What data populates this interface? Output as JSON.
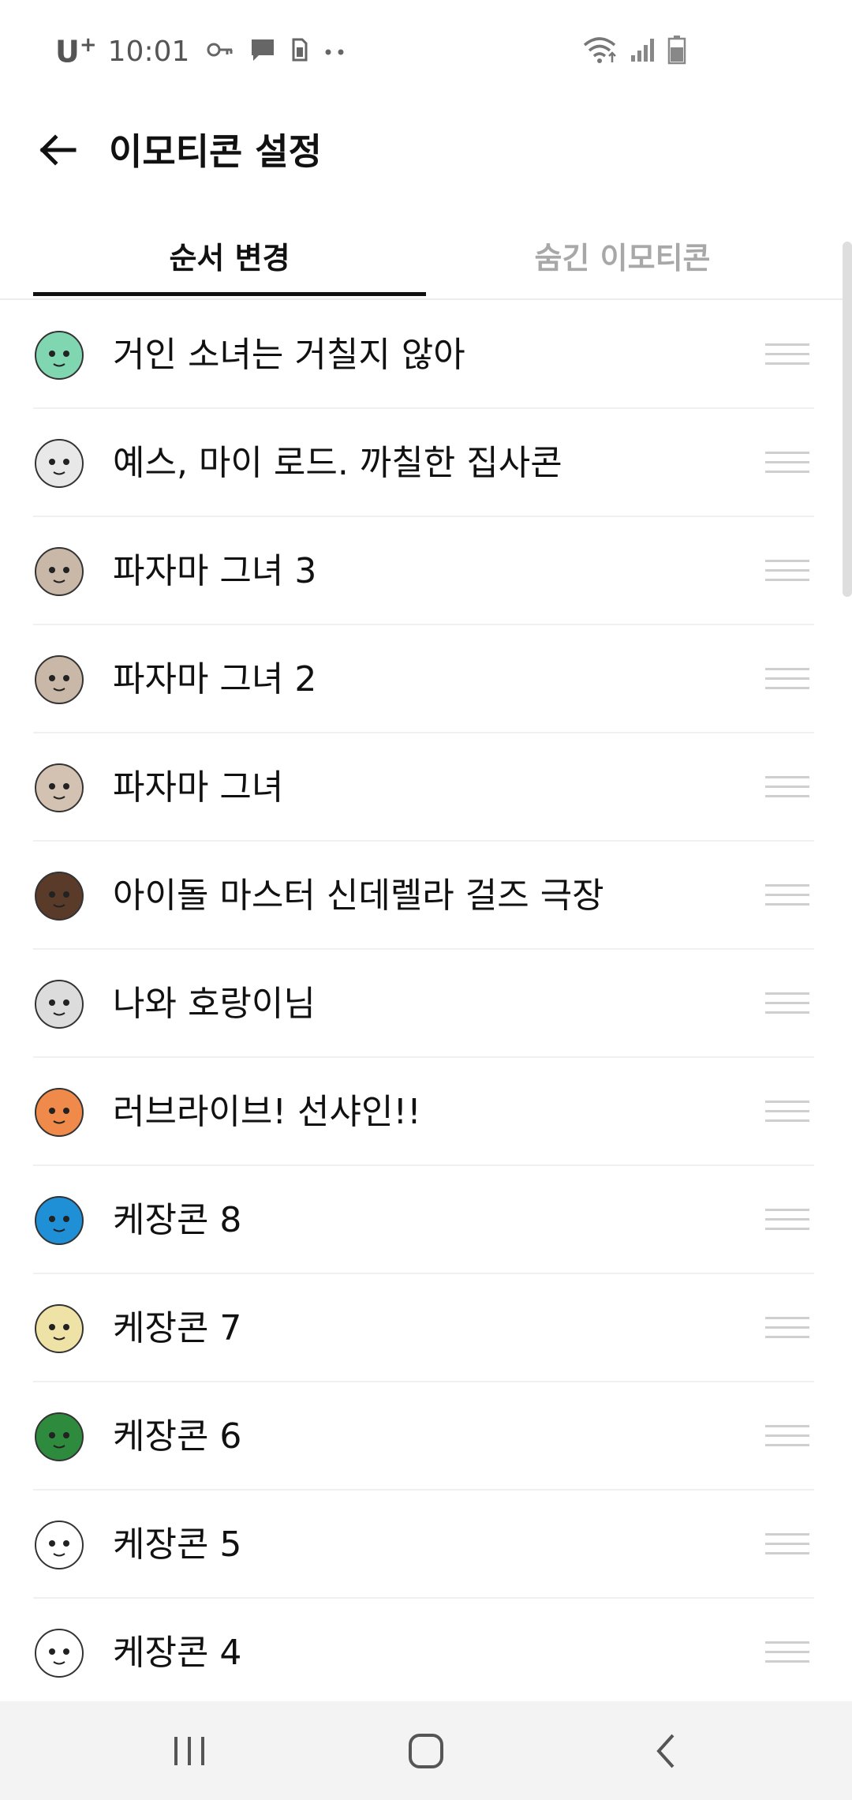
{
  "status_bar": {
    "carrier": "U",
    "carrier_sup": "+",
    "time": "10:01",
    "left_icons": [
      "key-icon",
      "chat-bubble-icon",
      "sim-icon",
      "more-dots-icon"
    ],
    "right_icons": [
      "wifi-icon",
      "signal-icon",
      "battery-icon"
    ]
  },
  "app_bar": {
    "title": "이모티콘 설정",
    "back_icon": "back-arrow-icon"
  },
  "tabs": {
    "order_label": "순서 변경",
    "hidden_label": "숨긴 이모티콘",
    "selected": "순서 변경"
  },
  "list": {
    "items": [
      {
        "label": "거인 소녀는 거칠지 않아",
        "thumb_color": "#7fd6b0"
      },
      {
        "label": "예스, 마이 로드. 까칠한 집사콘",
        "thumb_color": "#e8e8e8"
      },
      {
        "label": "파자마 그녀 3",
        "thumb_color": "#c9b7a7"
      },
      {
        "label": "파자마 그녀 2",
        "thumb_color": "#c9b7a7"
      },
      {
        "label": "파자마 그녀",
        "thumb_color": "#d3c1b1"
      },
      {
        "label": "아이돌 마스터 신데렐라 걸즈 극장",
        "thumb_color": "#5a3b2a"
      },
      {
        "label": "나와 호랑이님",
        "thumb_color": "#dcdcdc"
      },
      {
        "label": "러브라이브! 선샤인!!",
        "thumb_color": "#f08a4b"
      },
      {
        "label": "케장콘 8",
        "thumb_color": "#1f8fd6"
      },
      {
        "label": "케장콘 7",
        "thumb_color": "#efe2a7"
      },
      {
        "label": "케장콘 6",
        "thumb_color": "#2e8b3e"
      },
      {
        "label": "케장콘 5",
        "thumb_color": "#ffffff"
      },
      {
        "label": "케장콘 4",
        "thumb_color": "#ffffff"
      }
    ]
  },
  "nav_bar": {
    "recents_icon": "recent-apps-icon",
    "home_icon": "home-icon",
    "back_icon": "back-chevron-icon"
  }
}
